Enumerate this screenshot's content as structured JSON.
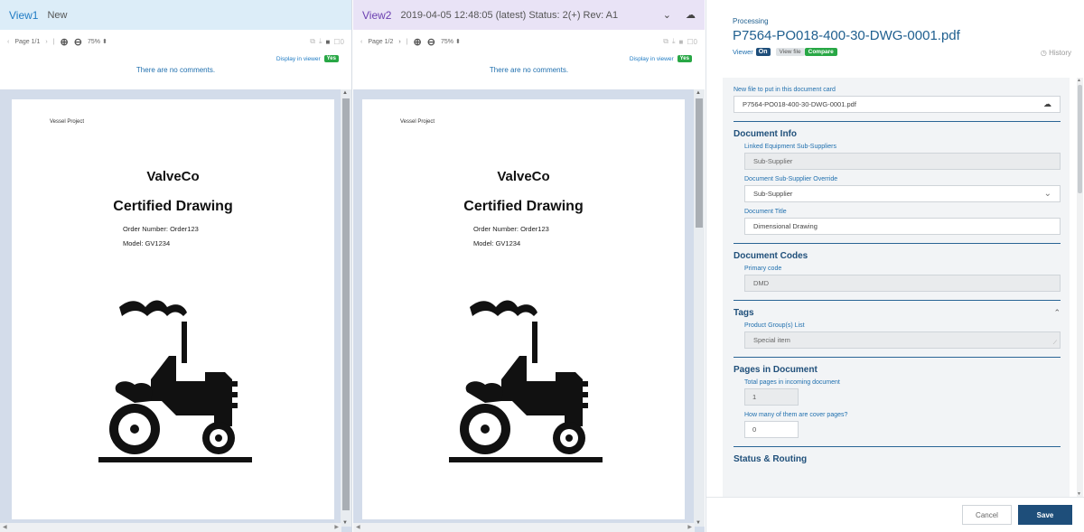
{
  "view1": {
    "title": "View1",
    "status": "New",
    "toolbar": {
      "prev": "‹",
      "page": "Page 1/1",
      "next": "›",
      "sep": "|",
      "zoom_in": "⊕",
      "zoom_out": "⊖",
      "zoom_level": "75% ⬍",
      "right_icons": [
        "⧉",
        "⤓",
        "■",
        "☐0"
      ]
    },
    "display_in_viewer": "Display in viewer",
    "display_badge": "Yes",
    "comments": "There are no comments.",
    "document": {
      "project": "Vessel Project",
      "company": "ValveCo",
      "heading": "Certified Drawing",
      "order": "Order Number: Order123",
      "model": "Model: GV1234"
    }
  },
  "view2": {
    "title": "View2",
    "meta": "2019-04-05 12:48:05 (latest) Status: 2(+) Rev: A1",
    "chevron_icon": "⌄",
    "cloud_icon": "☁",
    "toolbar": {
      "prev": "‹",
      "page": "Page 1/2",
      "next": "›",
      "sep": "|",
      "zoom_in": "⊕",
      "zoom_out": "⊖",
      "zoom_level": "75% ⬍",
      "right_icons": [
        "⧉",
        "⤓",
        "■",
        "☐0"
      ]
    },
    "display_in_viewer": "Display in viewer",
    "display_badge": "Yes",
    "comments": "There are no comments.",
    "document": {
      "project": "Vessel Project",
      "company": "ValveCo",
      "heading": "Certified Drawing",
      "order": "Order Number: Order123",
      "model": "Model: GV1234"
    }
  },
  "form": {
    "processing": "Processing",
    "filename": "P7564-PO018-400-30-DWG-0001.pdf",
    "viewer_label": "Viewer",
    "viewer_on": "On",
    "view_file": "View file",
    "compare": "Compare",
    "history": "◷ History",
    "new_file_label": "New file to put in this document card",
    "new_file_value": "P7564-PO018-400-30-DWG-0001.pdf",
    "upload_icon": "☁",
    "sections": {
      "doc_info": {
        "title": "Document Info",
        "linked_label": "Linked Equipment Sub-Suppliers",
        "linked_value": "Sub-Supplier",
        "override_label": "Document Sub-Supplier Override",
        "override_value": "Sub-Supplier",
        "override_chevron": "⌄",
        "title_label": "Document Title",
        "title_value": "Dimensional Drawing"
      },
      "codes": {
        "title": "Document Codes",
        "primary_label": "Primary code",
        "primary_value": "DMD"
      },
      "tags": {
        "title": "Tags",
        "collapse_icon": "⌃",
        "product_label": "Product Group(s) List",
        "product_value": "Special item",
        "grip": "⟋"
      },
      "pages": {
        "title": "Pages in Document",
        "total_label": "Total pages in incoming document",
        "total_value": "1",
        "cover_label": "How many of them are cover pages?",
        "cover_value": "0"
      },
      "status": {
        "title": "Status & Routing"
      }
    },
    "cancel": "Cancel",
    "save": "Save"
  },
  "colors": {
    "view1_header": "#dcedf8",
    "view2_header": "#e9e3f6",
    "accent_blue": "#1e4e7a",
    "link_blue": "#1f6fae",
    "success_green": "#28a745",
    "doc_background": "#d3dcea"
  }
}
